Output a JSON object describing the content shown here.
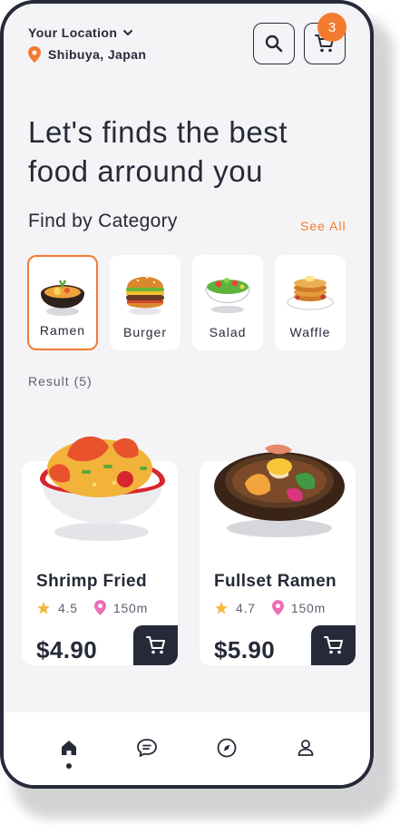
{
  "header": {
    "location_title": "Your Location",
    "location_value": "Shibuya, Japan",
    "cart_count": "3",
    "icons": [
      "chevron-down-icon",
      "location-pin-icon",
      "search-icon",
      "cart-icon"
    ]
  },
  "headline": "Let's finds the best food arround you",
  "category_section": {
    "title": "Find by Category",
    "see_all": "See All",
    "items": [
      {
        "label": "Ramen",
        "active": true
      },
      {
        "label": "Burger",
        "active": false
      },
      {
        "label": "Salad",
        "active": false
      },
      {
        "label": "Waffle",
        "active": false
      }
    ]
  },
  "result_text": "Result (5)",
  "products": [
    {
      "name": "Shrimp Fried",
      "rating": "4.5",
      "distance": "150m",
      "price": "$4.90"
    },
    {
      "name": "Fullset Ramen",
      "rating": "4.7",
      "distance": "150m",
      "price": "$5.90"
    }
  ],
  "nav": {
    "items": [
      "home-icon",
      "chat-icon",
      "compass-icon",
      "profile-icon"
    ],
    "active": "home-icon"
  },
  "colors": {
    "accent": "#f27b2f",
    "dark": "#262a38",
    "background": "#f4f4f6",
    "star": "#f5b942",
    "pin": "#e96fb6"
  }
}
